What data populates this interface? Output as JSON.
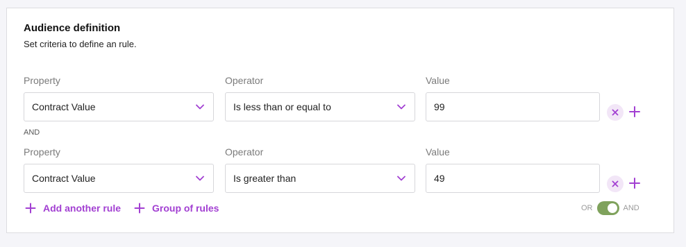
{
  "card": {
    "title": "Audience definition",
    "subtitle": "Set criteria to define an rule."
  },
  "labels": {
    "property": "Property",
    "operator": "Operator",
    "value": "Value"
  },
  "rules": [
    {
      "property": "Contract Value",
      "operator": "Is less than or equal to",
      "value": "99"
    },
    {
      "property": "Contract Value",
      "operator": "Is greater than",
      "value": "49"
    }
  ],
  "connector": "AND",
  "actions": {
    "add_rule": "Add another rule",
    "group_rules": "Group of rules"
  },
  "logic_toggle": {
    "left_label": "OR",
    "right_label": "AND",
    "selected": "AND"
  },
  "icons": {
    "dropdown": "chevron-down-icon",
    "remove": "close-icon",
    "add": "plus-icon"
  },
  "colors": {
    "accent": "#a23fd2",
    "remove_bg": "#f2e6f7",
    "toggle_on": "#7fa25c"
  }
}
